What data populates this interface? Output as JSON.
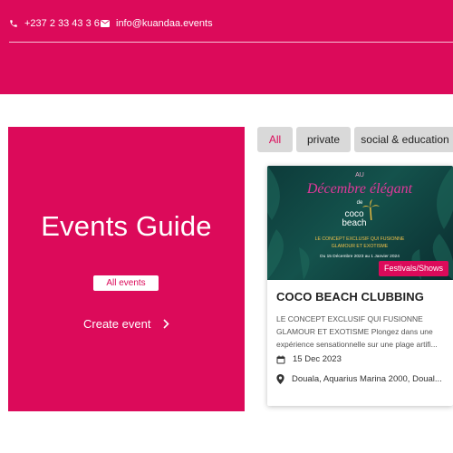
{
  "header": {
    "phone": "+237 2 33 43 3 6",
    "email": "info@kuandaa.events",
    "phone_icon": "phone-icon",
    "email_icon": "envelope-icon"
  },
  "guide": {
    "title": "Events Guide",
    "all_events_label": "All events",
    "create_event_label": "Create event",
    "create_event_icon": "chevron-right-icon"
  },
  "filters": [
    {
      "label": "All",
      "active": true
    },
    {
      "label": "private",
      "active": false
    },
    {
      "label": "social & education",
      "active": false
    }
  ],
  "event_card": {
    "poster": {
      "line1": "AU",
      "line2": "Décembre élégant",
      "line3": "de",
      "logo_line1": "coco",
      "logo_line2": "beach",
      "tagline1": "LE CONCEPT EXCLUSIF QUI FUSIONNE",
      "tagline2": "GLAMOUR ET EXOTISME",
      "dates": "Du 15 Décembre 2023 au 1 Janvier 2024"
    },
    "category": "Festivals/Shows",
    "title": "COCO BEACH CLUBBING",
    "description": "LE CONCEPT EXCLUSIF QUI FUSIONNE GLAMOUR ET EXOTISME Plongez dans une expérience sensationnelle sur une plage artifi...",
    "date": "15 Dec 2023",
    "location": "Douala, Aquarius Marina 2000, Doual..."
  },
  "colors": {
    "brand": "#dc0a5a",
    "filter_bg": "#d9d9d9"
  }
}
